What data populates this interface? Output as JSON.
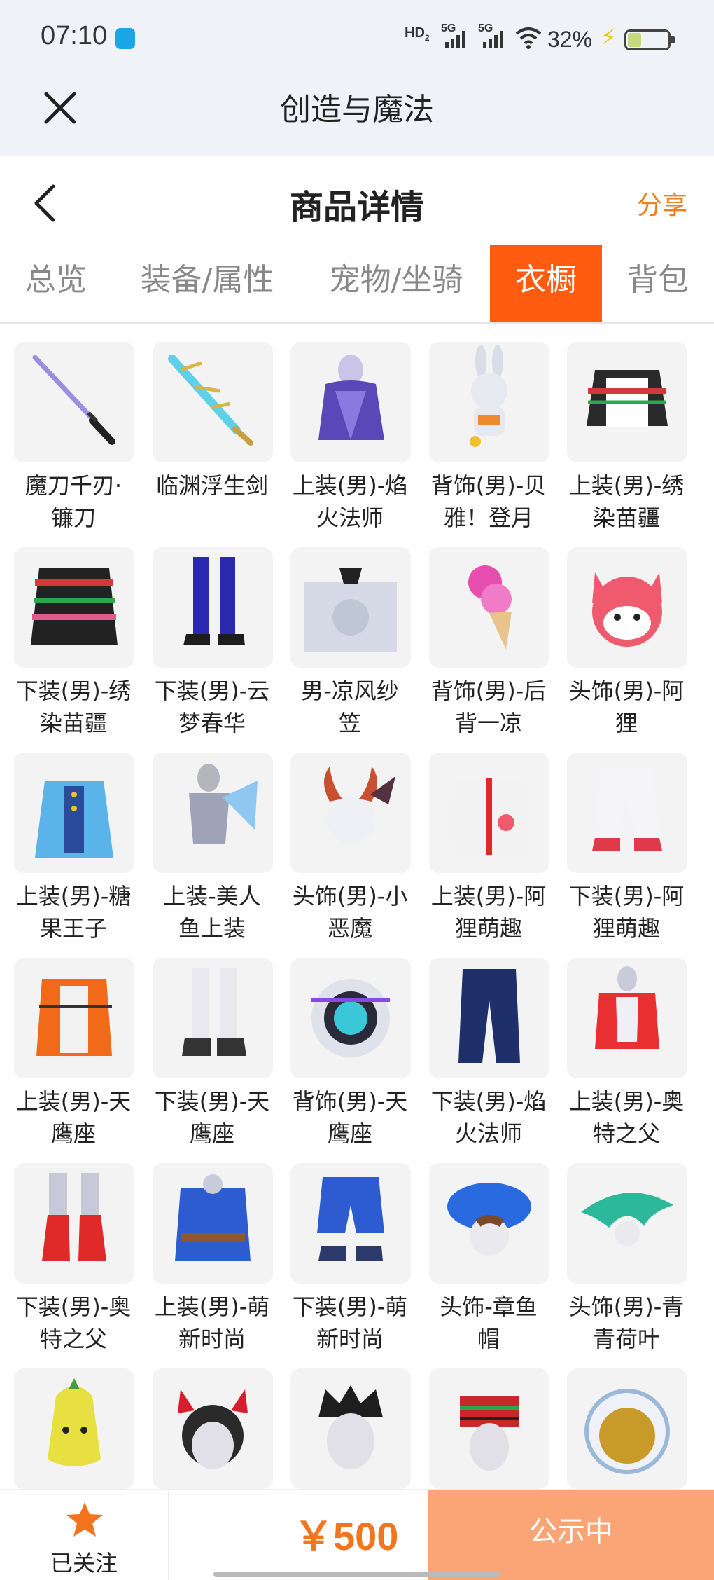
{
  "status_bar": {
    "time": "07:10",
    "sim1": "HD",
    "sim1_sub": "2",
    "net1": "5G",
    "net2": "5G",
    "battery": "32%",
    "battery_level": 0.32
  },
  "webview": {
    "title": "创造与魔法"
  },
  "page": {
    "title": "商品详情",
    "share": "分享"
  },
  "tabs": [
    {
      "label": "总览",
      "active": false
    },
    {
      "label": "装备/属性",
      "active": false
    },
    {
      "label": "宠物/坐骑",
      "active": false
    },
    {
      "label": "衣橱",
      "active": true
    },
    {
      "label": "背包",
      "active": false
    }
  ],
  "wardrobe": [
    {
      "line1": "魔刀千刃·",
      "line2": "镰刀",
      "icon": "katana-icon"
    },
    {
      "line1": "临渊浮生剑",
      "line2": "",
      "icon": "crystal-sword-icon"
    },
    {
      "line1": "上装(男)-焰",
      "line2": "火法师",
      "icon": "mage-armor-icon"
    },
    {
      "line1": "背饰(男)-贝",
      "line2": "雅！登月",
      "icon": "rabbit-astronaut-icon"
    },
    {
      "line1": "上装(男)-绣",
      "line2": "染苗疆",
      "icon": "embroidered-top-icon"
    },
    {
      "line1": "下装(男)-绣",
      "line2": "染苗疆",
      "icon": "embroidered-skirt-icon"
    },
    {
      "line1": "下装(男)-云",
      "line2": "梦春华",
      "icon": "blue-boots-icon"
    },
    {
      "line1": "男-凉风纱",
      "line2": "笠",
      "icon": "veil-hat-icon"
    },
    {
      "line1": "背饰(男)-后",
      "line2": "背一凉",
      "icon": "ice-cream-icon"
    },
    {
      "line1": "头饰(男)-阿",
      "line2": "狸",
      "icon": "fox-mask-icon"
    },
    {
      "line1": "上装(男)-糖",
      "line2": "果王子",
      "icon": "candy-prince-coat-icon"
    },
    {
      "line1": "上装-美人",
      "line2": "鱼上装",
      "icon": "mermaid-top-icon"
    },
    {
      "line1": "头饰(男)-小",
      "line2": "恶魔",
      "icon": "devil-horns-icon"
    },
    {
      "line1": "上装(男)-阿",
      "line2": "狸萌趣",
      "icon": "fox-hoodie-icon"
    },
    {
      "line1": "下装(男)-阿",
      "line2": "狸萌趣",
      "icon": "white-pants-icon"
    },
    {
      "line1": "上装(男)-天",
      "line2": "鹰座",
      "icon": "hawk-jacket-icon"
    },
    {
      "line1": "下装(男)-天",
      "line2": "鹰座",
      "icon": "hawk-boots-icon"
    },
    {
      "line1": "背饰(男)-天",
      "line2": "鹰座",
      "icon": "hawk-backpack-icon"
    },
    {
      "line1": "下装(男)-焰",
      "line2": "火法师",
      "icon": "navy-pants-icon"
    },
    {
      "line1": "上装(男)-奥",
      "line2": "特之父",
      "icon": "ultra-top-icon"
    },
    {
      "line1": "下装(男)-奥",
      "line2": "特之父",
      "icon": "red-boots-icon"
    },
    {
      "line1": "上装(男)-萌",
      "line2": "新时尚",
      "icon": "blue-robe-icon"
    },
    {
      "line1": "下装(男)-萌",
      "line2": "新时尚",
      "icon": "blue-shorts-icon"
    },
    {
      "line1": "头饰-章鱼",
      "line2": "帽",
      "icon": "octopus-hat-icon"
    },
    {
      "line1": "头饰(男)-青",
      "line2": "青荷叶",
      "icon": "lotus-leaf-hat-icon"
    },
    {
      "line1": "",
      "line2": "",
      "icon": "banana-head-icon"
    },
    {
      "line1": "",
      "line2": "",
      "icon": "cat-ear-headband-icon"
    },
    {
      "line1": "",
      "line2": "",
      "icon": "spiky-hair-icon"
    },
    {
      "line1": "",
      "line2": "",
      "icon": "embroidered-hat-icon"
    },
    {
      "line1": "",
      "line2": "",
      "icon": "astronaut-helmet-icon"
    }
  ],
  "bottom": {
    "follow_label": "已关注",
    "price": "￥500",
    "status_label": "公示中"
  },
  "colors": {
    "accent": "#ff5c10",
    "price": "#f3761f",
    "status_button": "#fba577",
    "header_bg": "#eff3f8"
  }
}
